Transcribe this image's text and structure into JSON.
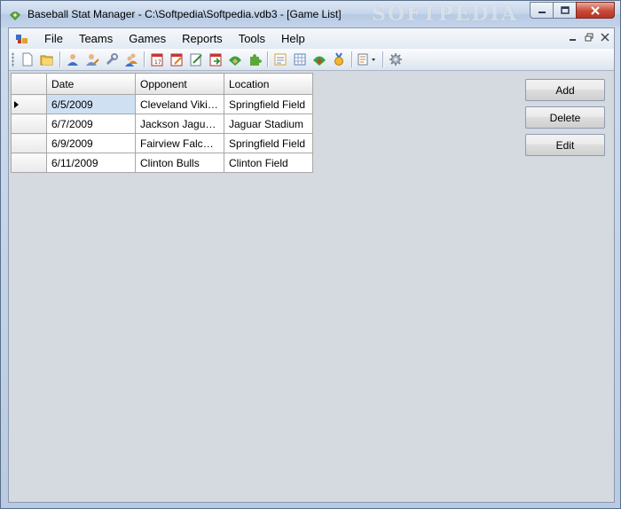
{
  "window": {
    "title": "Baseball Stat Manager - C:\\Softpedia\\Softpedia.vdb3 - [Game List]",
    "watermark": "SOFTPEDIA"
  },
  "menu": {
    "items": [
      "File",
      "Teams",
      "Games",
      "Reports",
      "Tools",
      "Help"
    ]
  },
  "grid": {
    "columns": [
      "Date",
      "Opponent",
      "Location"
    ],
    "rows": [
      {
        "date": "6/5/2009",
        "opponent": "Cleveland Viki…",
        "location": "Springfield Field"
      },
      {
        "date": "6/7/2009",
        "opponent": "Jackson Jaguars",
        "location": "Jaguar Stadium"
      },
      {
        "date": "6/9/2009",
        "opponent": "Fairview Falcons",
        "location": "Springfield Field"
      },
      {
        "date": "6/11/2009",
        "opponent": "Clinton Bulls",
        "location": "Clinton Field"
      }
    ]
  },
  "actions": {
    "add_label": "Add",
    "delete_label": "Delete",
    "edit_label": "Edit"
  },
  "colors": {
    "accent": "#cfe0f3",
    "content_bg": "#d5d9e0",
    "close_button": "#c74a36"
  },
  "icons": {
    "toolbar": [
      "new-icon",
      "open-icon",
      "player-icon",
      "player-edit-icon",
      "wrench-icon",
      "players-icon",
      "calendar-icon",
      "calendar-edit-icon",
      "note-edit-icon",
      "calendar-export-icon",
      "field-icon",
      "puzzle-icon",
      "report-icon",
      "spreadsheet-icon",
      "field-red-icon",
      "award-icon",
      "layout-dropdown-icon",
      "settings-icon"
    ]
  }
}
